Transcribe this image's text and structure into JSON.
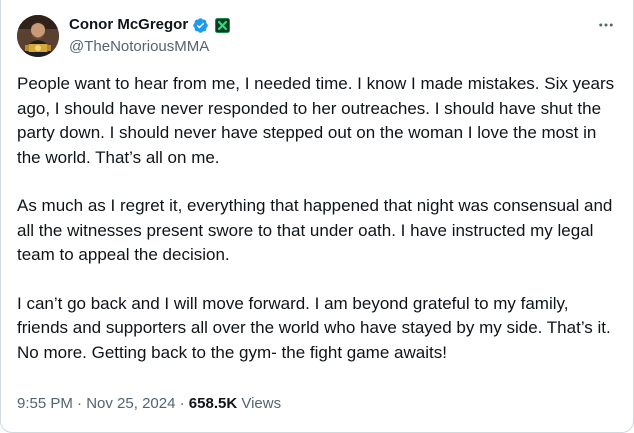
{
  "author": {
    "display_name": "Conor McGregor",
    "handle": "@TheNotoriousMMA",
    "avatar_icon": "profile-photo",
    "verified_icon": "verified-badge-icon",
    "affiliate_icon": "affiliate-badge-icon"
  },
  "more_icon": "more-options-icon",
  "tweet": {
    "paragraphs": [
      "People want to hear from me, I needed time. I know I made mistakes. Six years ago, I should have never responded to her outreaches. I should have shut the party down. I should never have stepped out on the woman I love the most in the world. That’s all on me.",
      "As much as I regret it, everything that happened that night was consensual and all the witnesses present swore to that under oath. I have instructed my legal team to appeal the decision.",
      "I can’t go back and I will move forward. I am beyond grateful to my family, friends and supporters all over the world who have stayed by my side. That’s it. No more. Getting back to the gym- the fight game awaits!"
    ],
    "time": "9:55 PM",
    "separator": "·",
    "date": "Nov 25, 2024",
    "views_count": "658.5K",
    "views_label": "Views"
  },
  "colors": {
    "verified": "#1d9bf0",
    "affiliate": "#1a8a4a",
    "secondary_text": "#536471",
    "primary_text": "#0f1419"
  }
}
